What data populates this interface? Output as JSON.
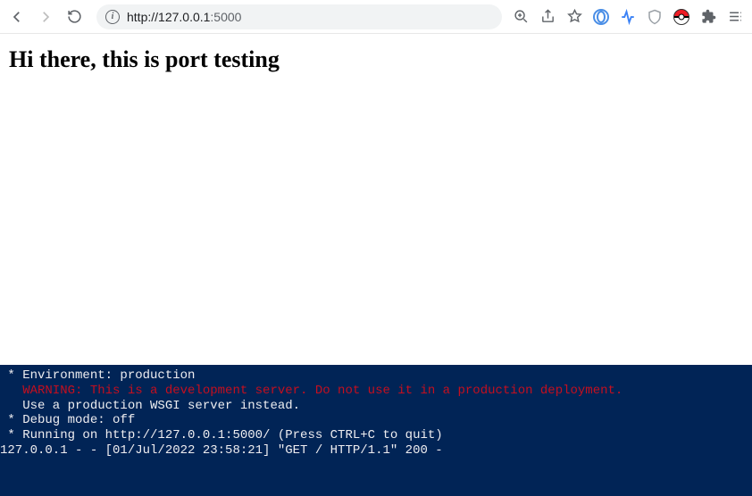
{
  "toolbar": {
    "url_host": "127.0.0.1",
    "url_port_path": ":5000",
    "url_full": "http://127.0.0.1:5000"
  },
  "page": {
    "heading": "Hi there, this is port testing"
  },
  "terminal": {
    "lines": [
      " * Environment: production",
      "   WARNING: This is a development server. Do not use it in a production deployment.",
      "   Use a production WSGI server instead.",
      " * Debug mode: off",
      " * Running on http://127.0.0.1:5000/ (Press CTRL+C to quit)",
      "127.0.0.1 - - [01/Jul/2022 23:58:21] \"GET / HTTP/1.1\" 200 -"
    ],
    "warn_index": 1
  }
}
